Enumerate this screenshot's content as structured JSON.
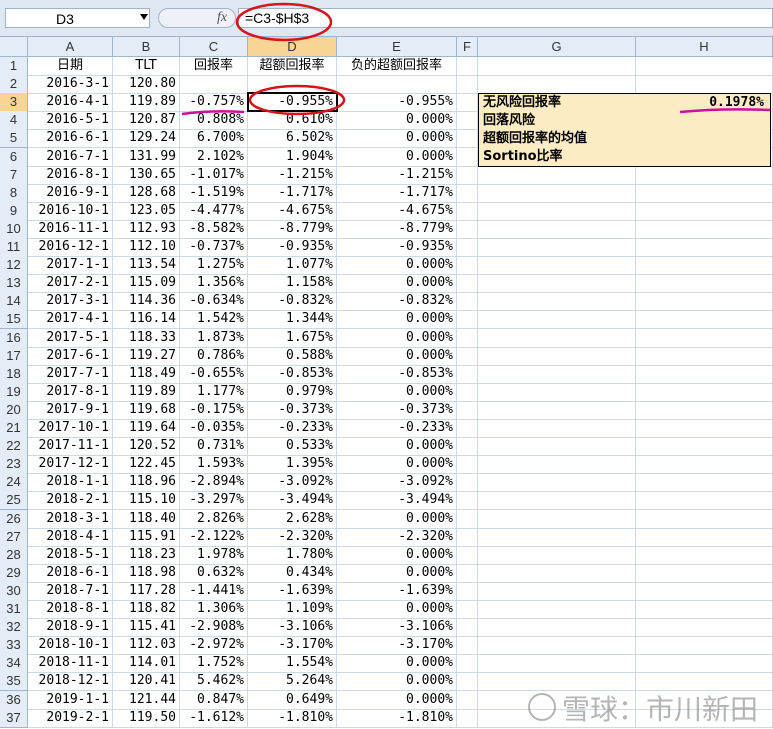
{
  "formula_bar": {
    "cell_ref": "D3",
    "fx": "fx",
    "formula": "=C3-$H$3"
  },
  "columns": [
    "A",
    "B",
    "C",
    "D",
    "E",
    "F",
    "G",
    "H"
  ],
  "rows": [
    {
      "n": "1",
      "a": "日期",
      "b": "TLT",
      "c": "回报率",
      "d": "超额回报率",
      "e": "负的超额回报率"
    },
    {
      "n": "2",
      "a": "2016-3-1",
      "b": "120.80",
      "c": "",
      "d": "",
      "e": ""
    },
    {
      "n": "3",
      "a": "2016-4-1",
      "b": "119.89",
      "c": "-0.757%",
      "d": "-0.955%",
      "e": "-0.955%"
    },
    {
      "n": "4",
      "a": "2016-5-1",
      "b": "120.87",
      "c": "0.808%",
      "d": "0.610%",
      "e": "0.000%"
    },
    {
      "n": "5",
      "a": "2016-6-1",
      "b": "129.24",
      "c": "6.700%",
      "d": "6.502%",
      "e": "0.000%"
    },
    {
      "n": "6",
      "a": "2016-7-1",
      "b": "131.99",
      "c": "2.102%",
      "d": "1.904%",
      "e": "0.000%"
    },
    {
      "n": "7",
      "a": "2016-8-1",
      "b": "130.65",
      "c": "-1.017%",
      "d": "-1.215%",
      "e": "-1.215%"
    },
    {
      "n": "8",
      "a": "2016-9-1",
      "b": "128.68",
      "c": "-1.519%",
      "d": "-1.717%",
      "e": "-1.717%"
    },
    {
      "n": "9",
      "a": "2016-10-1",
      "b": "123.05",
      "c": "-4.477%",
      "d": "-4.675%",
      "e": "-4.675%"
    },
    {
      "n": "10",
      "a": "2016-11-1",
      "b": "112.93",
      "c": "-8.582%",
      "d": "-8.779%",
      "e": "-8.779%"
    },
    {
      "n": "11",
      "a": "2016-12-1",
      "b": "112.10",
      "c": "-0.737%",
      "d": "-0.935%",
      "e": "-0.935%"
    },
    {
      "n": "12",
      "a": "2017-1-1",
      "b": "113.54",
      "c": "1.275%",
      "d": "1.077%",
      "e": "0.000%"
    },
    {
      "n": "13",
      "a": "2017-2-1",
      "b": "115.09",
      "c": "1.356%",
      "d": "1.158%",
      "e": "0.000%"
    },
    {
      "n": "14",
      "a": "2017-3-1",
      "b": "114.36",
      "c": "-0.634%",
      "d": "-0.832%",
      "e": "-0.832%"
    },
    {
      "n": "15",
      "a": "2017-4-1",
      "b": "116.14",
      "c": "1.542%",
      "d": "1.344%",
      "e": "0.000%"
    },
    {
      "n": "16",
      "a": "2017-5-1",
      "b": "118.33",
      "c": "1.873%",
      "d": "1.675%",
      "e": "0.000%"
    },
    {
      "n": "17",
      "a": "2017-6-1",
      "b": "119.27",
      "c": "0.786%",
      "d": "0.588%",
      "e": "0.000%"
    },
    {
      "n": "18",
      "a": "2017-7-1",
      "b": "118.49",
      "c": "-0.655%",
      "d": "-0.853%",
      "e": "-0.853%"
    },
    {
      "n": "19",
      "a": "2017-8-1",
      "b": "119.89",
      "c": "1.177%",
      "d": "0.979%",
      "e": "0.000%"
    },
    {
      "n": "20",
      "a": "2017-9-1",
      "b": "119.68",
      "c": "-0.175%",
      "d": "-0.373%",
      "e": "-0.373%"
    },
    {
      "n": "21",
      "a": "2017-10-1",
      "b": "119.64",
      "c": "-0.035%",
      "d": "-0.233%",
      "e": "-0.233%"
    },
    {
      "n": "22",
      "a": "2017-11-1",
      "b": "120.52",
      "c": "0.731%",
      "d": "0.533%",
      "e": "0.000%"
    },
    {
      "n": "23",
      "a": "2017-12-1",
      "b": "122.45",
      "c": "1.593%",
      "d": "1.395%",
      "e": "0.000%"
    },
    {
      "n": "24",
      "a": "2018-1-1",
      "b": "118.96",
      "c": "-2.894%",
      "d": "-3.092%",
      "e": "-3.092%"
    },
    {
      "n": "25",
      "a": "2018-2-1",
      "b": "115.10",
      "c": "-3.297%",
      "d": "-3.494%",
      "e": "-3.494%"
    },
    {
      "n": "26",
      "a": "2018-3-1",
      "b": "118.40",
      "c": "2.826%",
      "d": "2.628%",
      "e": "0.000%"
    },
    {
      "n": "27",
      "a": "2018-4-1",
      "b": "115.91",
      "c": "-2.122%",
      "d": "-2.320%",
      "e": "-2.320%"
    },
    {
      "n": "28",
      "a": "2018-5-1",
      "b": "118.23",
      "c": "1.978%",
      "d": "1.780%",
      "e": "0.000%"
    },
    {
      "n": "29",
      "a": "2018-6-1",
      "b": "118.98",
      "c": "0.632%",
      "d": "0.434%",
      "e": "0.000%"
    },
    {
      "n": "30",
      "a": "2018-7-1",
      "b": "117.28",
      "c": "-1.441%",
      "d": "-1.639%",
      "e": "-1.639%"
    },
    {
      "n": "31",
      "a": "2018-8-1",
      "b": "118.82",
      "c": "1.306%",
      "d": "1.109%",
      "e": "0.000%"
    },
    {
      "n": "32",
      "a": "2018-9-1",
      "b": "115.41",
      "c": "-2.908%",
      "d": "-3.106%",
      "e": "-3.106%"
    },
    {
      "n": "33",
      "a": "2018-10-1",
      "b": "112.03",
      "c": "-2.972%",
      "d": "-3.170%",
      "e": "-3.170%"
    },
    {
      "n": "34",
      "a": "2018-11-1",
      "b": "114.01",
      "c": "1.752%",
      "d": "1.554%",
      "e": "0.000%"
    },
    {
      "n": "35",
      "a": "2018-12-1",
      "b": "120.41",
      "c": "5.462%",
      "d": "5.264%",
      "e": "0.000%"
    },
    {
      "n": "36",
      "a": "2019-1-1",
      "b": "121.44",
      "c": "0.847%",
      "d": "0.649%",
      "e": "0.000%"
    },
    {
      "n": "37",
      "a": "2019-2-1",
      "b": "119.50",
      "c": "-1.612%",
      "d": "-1.810%",
      "e": "-1.810%"
    }
  ],
  "summary_box": {
    "risk_free_label": "无风险回报率",
    "risk_free_value": "0.1978%",
    "downside_label": "回落风险",
    "mean_excess_label": "超额回报率的均值",
    "sortino_label": "Sortino比率"
  },
  "selected_cell": "D3",
  "active_column": "D",
  "active_row": "3",
  "colors": {
    "header_bg": "#e4ecf7",
    "active_header_bg": "#f8d594",
    "summary_bg": "#fcecc4",
    "annotation_red": "#d7141a",
    "annotation_magenta": "#c8139b"
  },
  "watermark": "雪球：市川新田"
}
